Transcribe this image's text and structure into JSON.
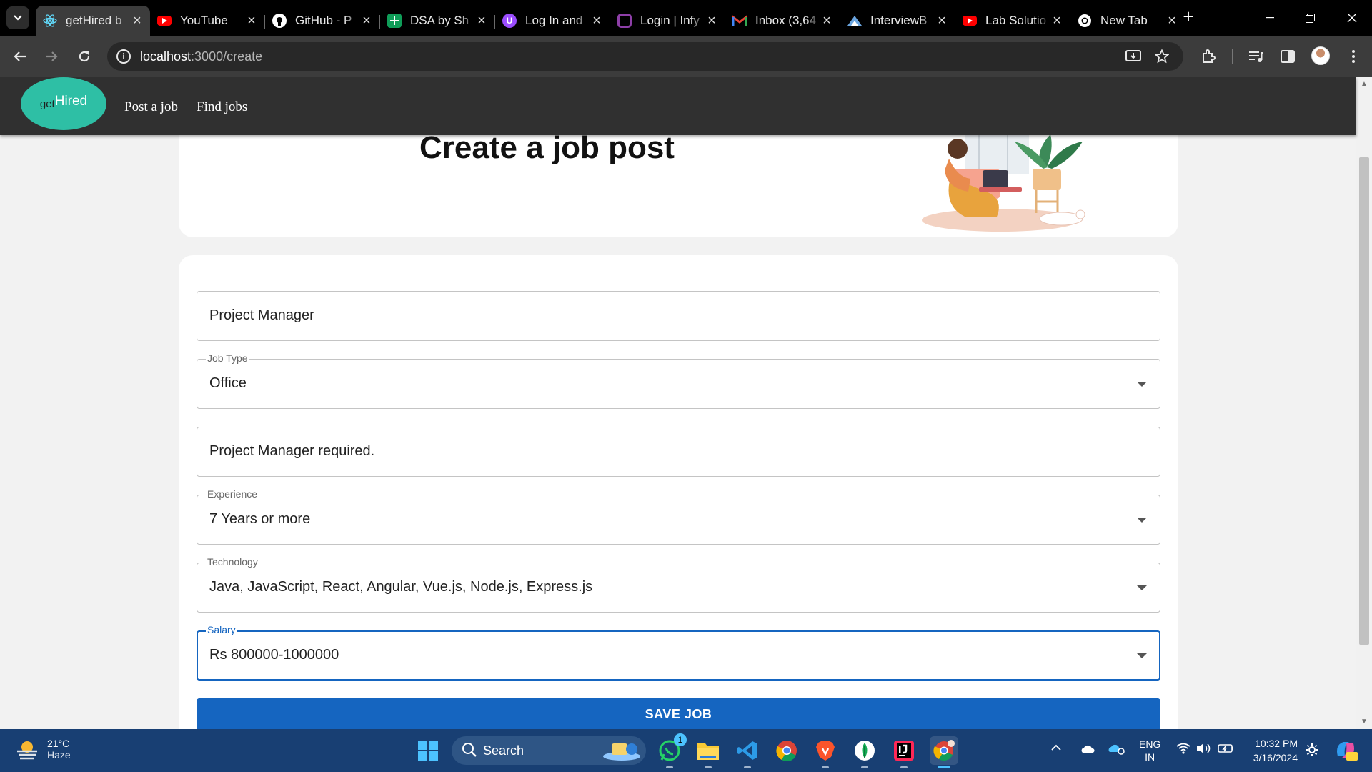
{
  "browser": {
    "tabs": [
      {
        "title": "getHired b",
        "favicon": "react-icon",
        "color": "#61dafb",
        "active": true
      },
      {
        "title": "YouTube",
        "favicon": "youtube-icon",
        "color": "#ff0000"
      },
      {
        "title": "GitHub - P",
        "favicon": "github-icon",
        "color": "#ffffff"
      },
      {
        "title": "DSA by Sh",
        "favicon": "sheets-icon",
        "color": "#0f9d58"
      },
      {
        "title": "Log In and",
        "favicon": "app-icon",
        "color": "#9b4dff"
      },
      {
        "title": "Login | Infy",
        "favicon": "infy-icon",
        "color": "#8e3fa8"
      },
      {
        "title": "Inbox (3,64",
        "favicon": "gmail-icon",
        "color": "#ea4335"
      },
      {
        "title": "InterviewB",
        "favicon": "interviewbit-icon",
        "color": "#6aa5e0"
      },
      {
        "title": "Lab Solutio",
        "favicon": "youtube-icon",
        "color": "#ff0000"
      },
      {
        "title": "New Tab",
        "favicon": "chrome-icon",
        "color": "#ffffff"
      }
    ],
    "url_host": "localhost",
    "url_path": ":3000/create"
  },
  "app": {
    "logo_prefix": "get",
    "logo_main": "Hired",
    "nav": [
      "Post a job",
      "Find jobs"
    ],
    "brand_color": "#2ebfa5"
  },
  "page": {
    "title": "Create a job post"
  },
  "form": {
    "profile": {
      "value": "Project Manager"
    },
    "job_type": {
      "label": "Job Type",
      "value": "Office"
    },
    "description": {
      "value": "Project Manager required."
    },
    "experience": {
      "label": "Experience",
      "value": "7 Years or more"
    },
    "technology": {
      "label": "Technology",
      "value": "Java, JavaScript, React, Angular, Vue.js, Node.js, Express.js"
    },
    "salary": {
      "label": "Salary",
      "value": "Rs 800000-1000000"
    },
    "save_label": "SAVE JOB",
    "accent_color": "#1565c0"
  },
  "taskbar": {
    "weather_temp": "21°C",
    "weather_desc": "Haze",
    "search_label": "Search",
    "whatsapp_badge": "1",
    "lang_top": "ENG",
    "lang_bottom": "IN",
    "time": "10:32 PM",
    "date": "3/16/2024"
  }
}
